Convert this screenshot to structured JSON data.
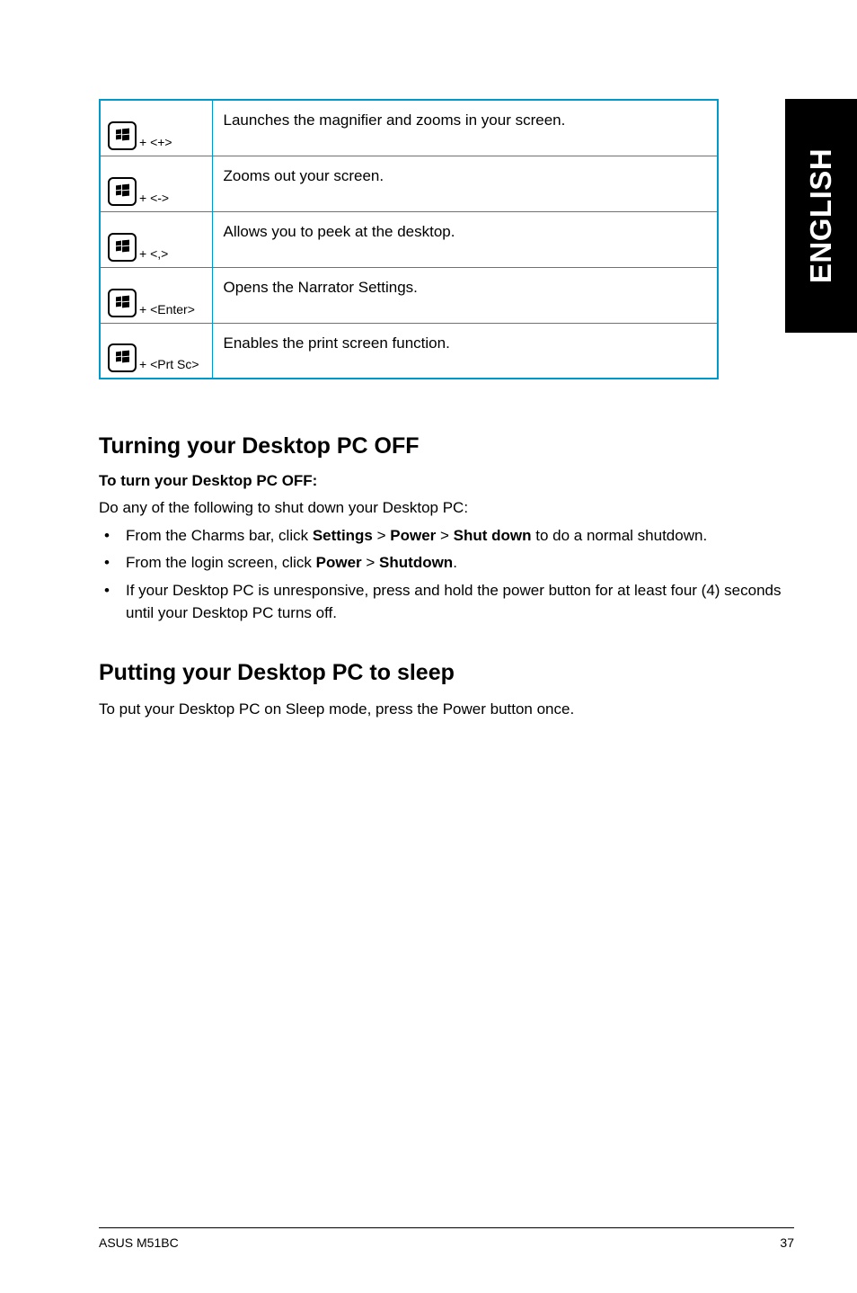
{
  "sideTab": "ENGLISH",
  "shortcuts": [
    {
      "suffix": "+ <+>",
      "desc": "Launches the magnifier and zooms in your screen."
    },
    {
      "suffix": "+ <->",
      "desc": "Zooms out your screen."
    },
    {
      "suffix": "+ <,>",
      "desc": "Allows you to peek at the desktop."
    },
    {
      "suffix": "+ <Enter>",
      "desc": "Opens the Narrator Settings."
    },
    {
      "suffix": "+ <Prt Sc>",
      "desc": "Enables the print screen function."
    }
  ],
  "section1": {
    "heading": "Turning your Desktop PC OFF",
    "subheading": "To turn your Desktop PC OFF:",
    "intro": "Do any of the following to shut down your Desktop PC:",
    "bullets": [
      {
        "pre": "From the Charms bar, click ",
        "b1": "Settings",
        "sep1": " > ",
        "b2": "Power",
        "sep2": " > ",
        "b3": "Shut down",
        "post": " to do a normal shutdown."
      },
      {
        "pre": "From the login screen, click ",
        "b1": "Power",
        "sep1": " > ",
        "b2": "Shutdown",
        "post": "."
      },
      {
        "pre": "If your Desktop PC is unresponsive, press and hold the power  button for at least four (4) seconds until your Desktop PC turns off."
      }
    ]
  },
  "section2": {
    "heading": "Putting your Desktop PC to sleep",
    "body": "To put your Desktop PC on Sleep mode, press the Power button once."
  },
  "footer": {
    "left": "ASUS M51BC",
    "right": "37"
  }
}
